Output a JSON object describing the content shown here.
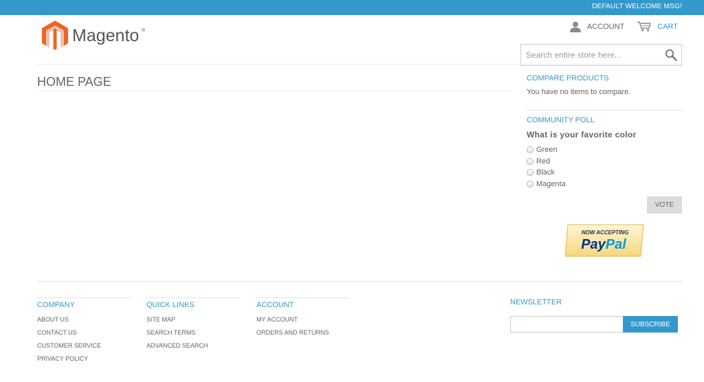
{
  "topbar": {
    "welcome": "DEFAULT WELCOME MSG!",
    "color": "#3399cc"
  },
  "logo": {
    "wordmark": "Magento",
    "registered": "®",
    "brand_color": "#f26322"
  },
  "header": {
    "account_label": "ACCOUNT",
    "cart_label": "CART",
    "search_placeholder": "Search entire store here..."
  },
  "main": {
    "page_title": "HOME PAGE"
  },
  "sidebar": {
    "compare": {
      "title": "COMPARE PRODUCTS",
      "text": "You have no items to compare."
    },
    "poll": {
      "title": "COMMUNITY POLL",
      "question": "What is your favorite color",
      "options": [
        "Green",
        "Red",
        "Black",
        "Magenta"
      ],
      "vote_label": "VOTE"
    },
    "paypal": {
      "line1": "NOW ACCEPTING",
      "pay": "Pay",
      "pal": "Pal"
    }
  },
  "footer": {
    "columns": [
      {
        "title": "COMPANY",
        "links": [
          "ABOUT US",
          "CONTACT US",
          "CUSTOMER SERVICE",
          "PRIVACY POLICY"
        ]
      },
      {
        "title": "QUICK LINKS",
        "links": [
          "SITE MAP",
          "SEARCH TERMS",
          "ADVANCED SEARCH"
        ]
      },
      {
        "title": "ACCOUNT",
        "links": [
          "MY ACCOUNT",
          "ORDERS AND RETURNS"
        ]
      }
    ],
    "newsletter": {
      "title": "NEWSLETTER",
      "subscribe_label": "SUBSCRIBE"
    }
  },
  "colors": {
    "accent": "#3399cc",
    "text": "#636363",
    "vote_bg": "#dcdcdc"
  }
}
